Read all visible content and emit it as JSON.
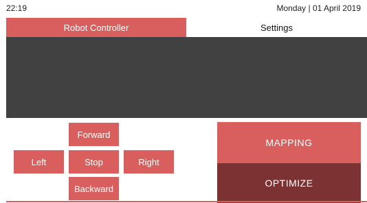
{
  "status_bar": {
    "time": "22:19",
    "date": "Monday | 01 April 2019"
  },
  "tabs": [
    {
      "label": "Robot Controller",
      "active": true
    },
    {
      "label": "Settings",
      "active": false
    }
  ],
  "controls": {
    "forward": "Forward",
    "left": "Left",
    "stop": "Stop",
    "right": "Right",
    "backward": "Backward"
  },
  "actions": {
    "mapping": "MAPPING",
    "optimize": "OPTIMIZE"
  },
  "colors": {
    "accent": "#d95f5f",
    "accent_dark": "#7c3232",
    "panel": "#414141"
  }
}
